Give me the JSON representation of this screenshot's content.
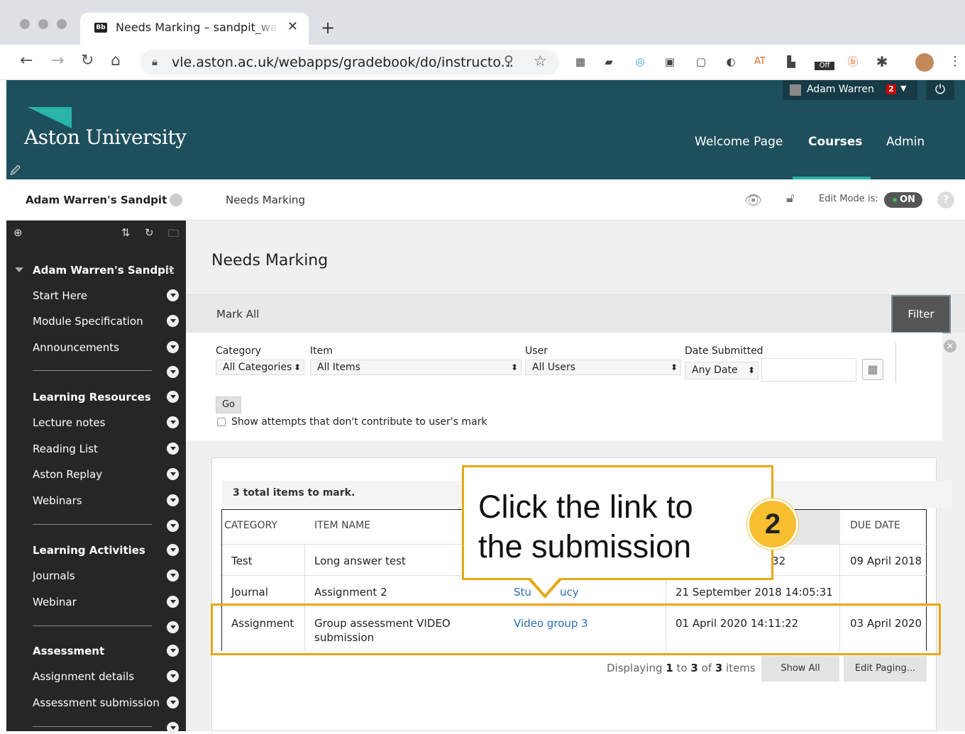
{
  "browser": {
    "tab_favicon": "Bb",
    "tab_title": "Needs Marking – sandpit_warren",
    "tab_close": "✕",
    "new_tab": "+",
    "url": "vle.aston.ac.uk/webapps/gradebook/do/instructo...",
    "ext_at": "AT",
    "ext_off": "Off"
  },
  "header": {
    "logo": "Aston University",
    "user_name": "Adam Warren",
    "notification_count": "2",
    "nav": [
      "Welcome Page",
      "Courses",
      "Admin"
    ]
  },
  "breadcrumb": {
    "course": "Adam Warren's Sandpit",
    "page": "Needs Marking",
    "edit_mode_label": "Edit Mode is:",
    "edit_mode_value": "ON",
    "help": "?"
  },
  "sidebar": {
    "course_title": "Adam Warren's Sandpit",
    "items": [
      {
        "label": "Start Here"
      },
      {
        "label": "Module Specification"
      },
      {
        "label": "Announcements"
      },
      {
        "label": "Learning Resources",
        "heading": true
      },
      {
        "label": "Lecture notes"
      },
      {
        "label": "Reading List"
      },
      {
        "label": "Aston Replay"
      },
      {
        "label": "Webinars"
      },
      {
        "label": "Learning Activities",
        "heading": true
      },
      {
        "label": "Journals"
      },
      {
        "label": "Webinar"
      },
      {
        "label": "Assessment",
        "heading": true
      },
      {
        "label": "Assignment details"
      },
      {
        "label": "Assessment submission"
      }
    ]
  },
  "main": {
    "title": "Needs Marking",
    "mark_all": "Mark All",
    "filter": "Filter",
    "filters": {
      "category_label": "Category",
      "category_value": "All Categories",
      "item_label": "Item",
      "item_value": "All Items",
      "user_label": "User",
      "user_value": "All Users",
      "date_label": "Date Submitted",
      "date_value": "Any Date",
      "go": "Go",
      "show_attempts": "Show attempts that don't contribute to user's mark"
    },
    "total": "3 total items to mark.",
    "columns": [
      "CATEGORY",
      "ITEM NAME",
      "DUE DATE"
    ],
    "rows": [
      {
        "category": "Test",
        "item": "Long answer test",
        "user": "",
        "date": ":32",
        "due": "09 April 2018"
      },
      {
        "category": "Journal",
        "item": "Assignment 2",
        "user": "Stu",
        "user_tail": "ucy",
        "date": "21 September 2018 14:05:31",
        "due": ""
      },
      {
        "category": "Assignment",
        "item": "Group assessment VIDEO submission",
        "user": "Video group 3",
        "date": "01 April 2020 14:11:22",
        "due": "03 April 2020"
      }
    ],
    "paging": {
      "prefix": "Displaying",
      "from": "1",
      "to_word": "to",
      "to": "3",
      "of_word": "of",
      "total": "3",
      "suffix": "items"
    },
    "show_all": "Show All",
    "edit_paging": "Edit Paging..."
  },
  "callout": {
    "text_line1": "Click the link to",
    "text_line2": "the submission",
    "step": "2"
  },
  "colors": {
    "header_teal": "#1e4f5d",
    "accent_teal": "#2ab3a8",
    "callout_gold": "#e6a817",
    "link_blue": "#2a6ebb"
  }
}
